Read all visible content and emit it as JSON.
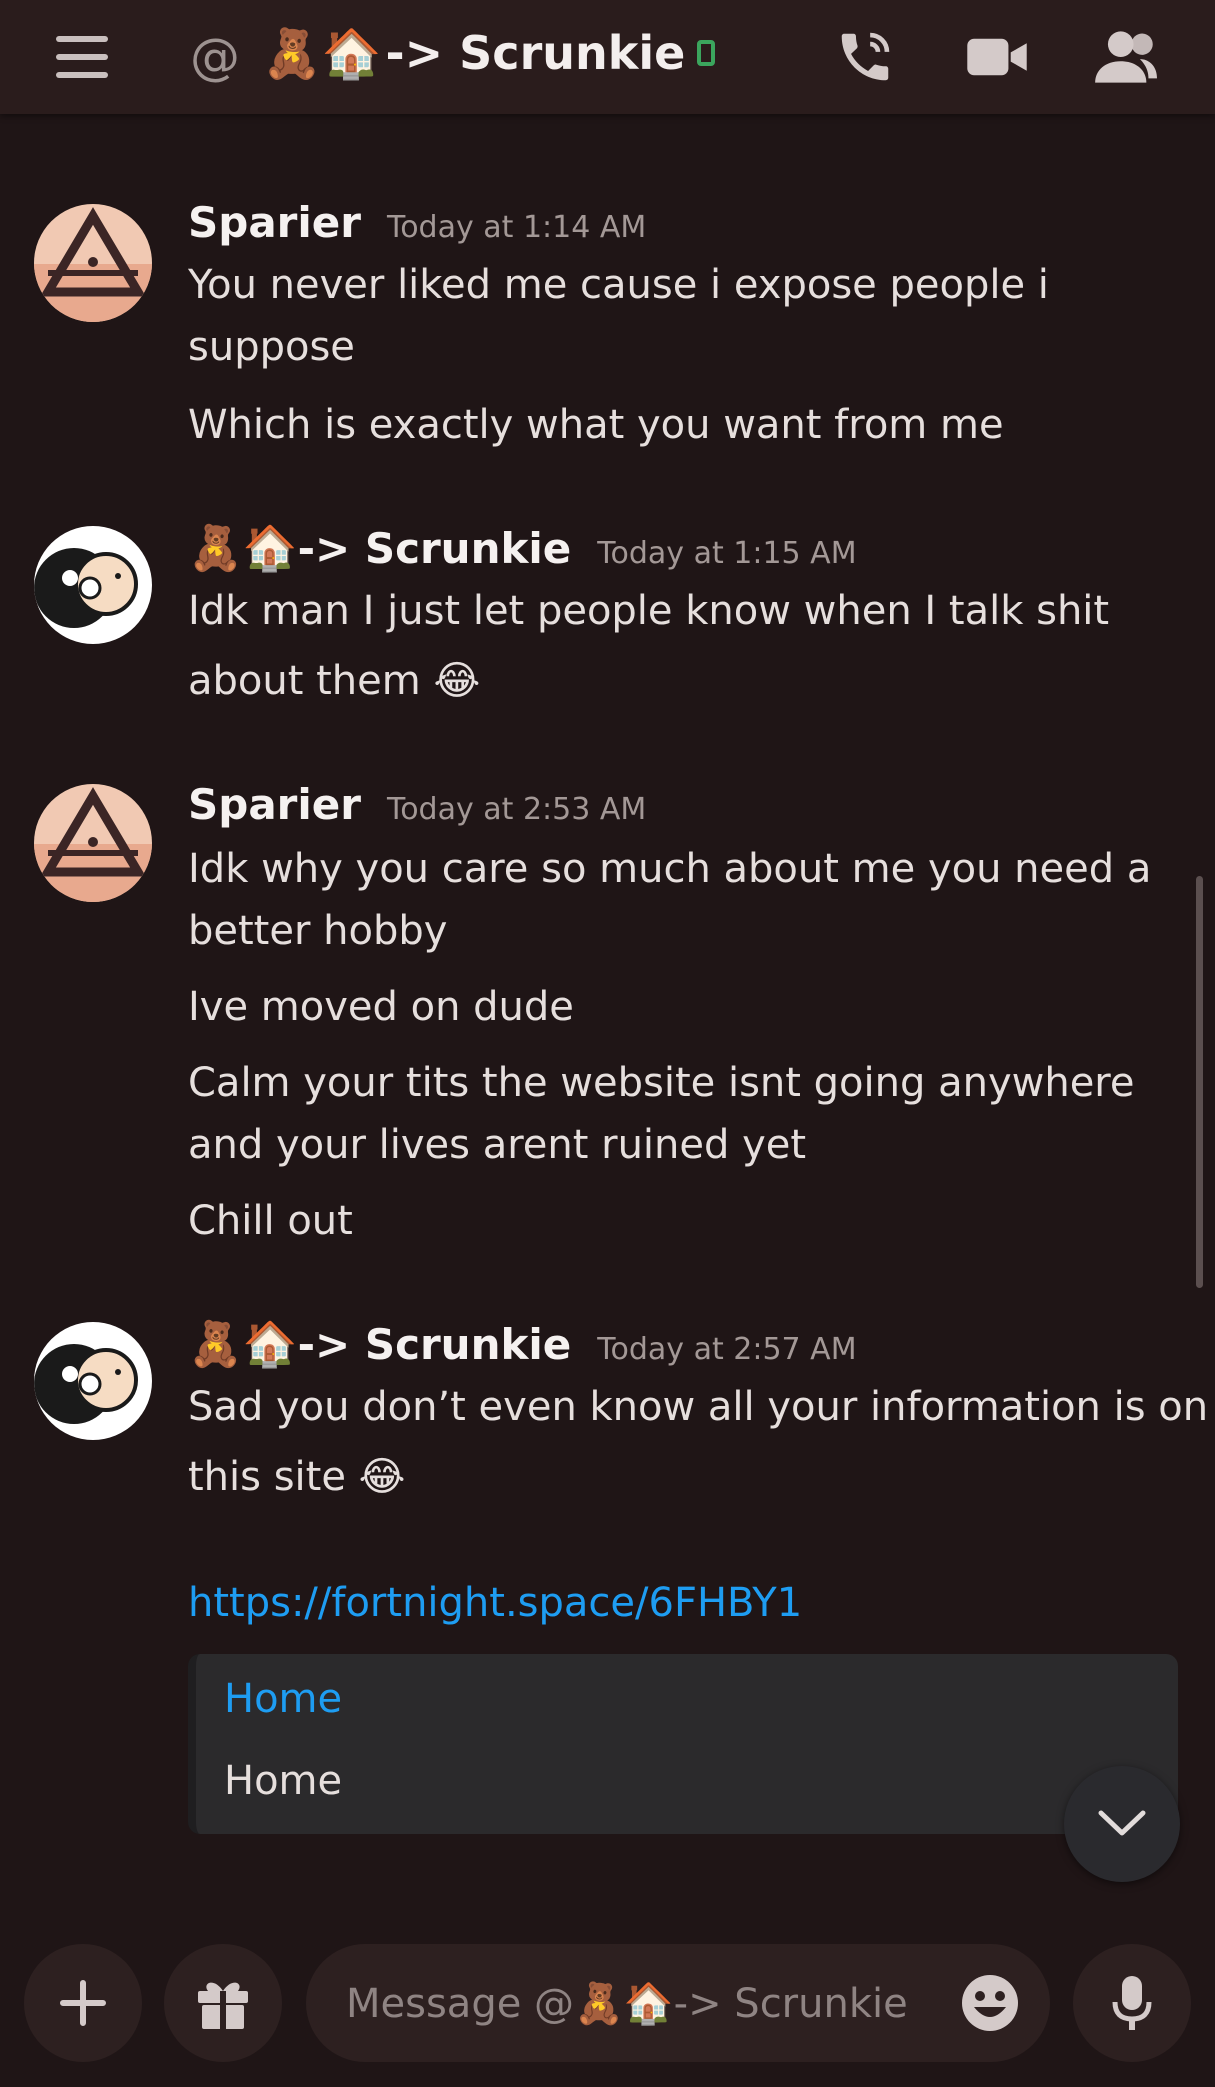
{
  "header": {
    "at_symbol": "@",
    "channel_emoji": "🧸🏠",
    "channel_name": "-> Scrunkie"
  },
  "messages": [
    {
      "author": "Sparier",
      "author_emoji": "",
      "timestamp": "Today at 1:14 AM",
      "lines": [
        "You never liked me cause i expose people i",
        "suppose",
        "Which is exactly what you want from me"
      ]
    },
    {
      "author": "-> Scrunkie",
      "author_emoji": "🧸🏠",
      "timestamp": "Today at 1:15 AM",
      "lines": [
        "Idk man I just let people know when I talk shit",
        "about them"
      ],
      "trailing_emoji": "😂"
    },
    {
      "author": "Sparier",
      "author_emoji": "",
      "timestamp": "Today at 2:53 AM",
      "lines": [
        "Idk why you care so much about me you need a",
        "better hobby",
        "Ive moved on dude",
        "Calm your tits the website isnt going anywhere",
        "and your lives arent ruined yet",
        "Chill out"
      ]
    },
    {
      "author": "-> Scrunkie",
      "author_emoji": "🧸🏠",
      "timestamp": "Today at 2:57 AM",
      "lines": [
        "Sad you don’t even know all your information is on",
        "this site"
      ],
      "trailing_emoji": "😂",
      "link": "https://fortnight.space/6FHBY1",
      "embed": {
        "title": "Home",
        "description": "Home"
      }
    }
  ],
  "composer": {
    "placeholder": "Message @🧸🏠-> Scrunkie"
  },
  "icons": [
    "hamburger-menu-icon",
    "at-icon",
    "phone-status-icon",
    "call-icon",
    "video-icon",
    "members-icon",
    "chevron-down-icon",
    "plus-icon",
    "gift-icon",
    "emoji-icon",
    "microphone-icon"
  ],
  "colors": {
    "link": "#1e9df2",
    "online": "#3ba55d",
    "background": "#1f1516"
  }
}
